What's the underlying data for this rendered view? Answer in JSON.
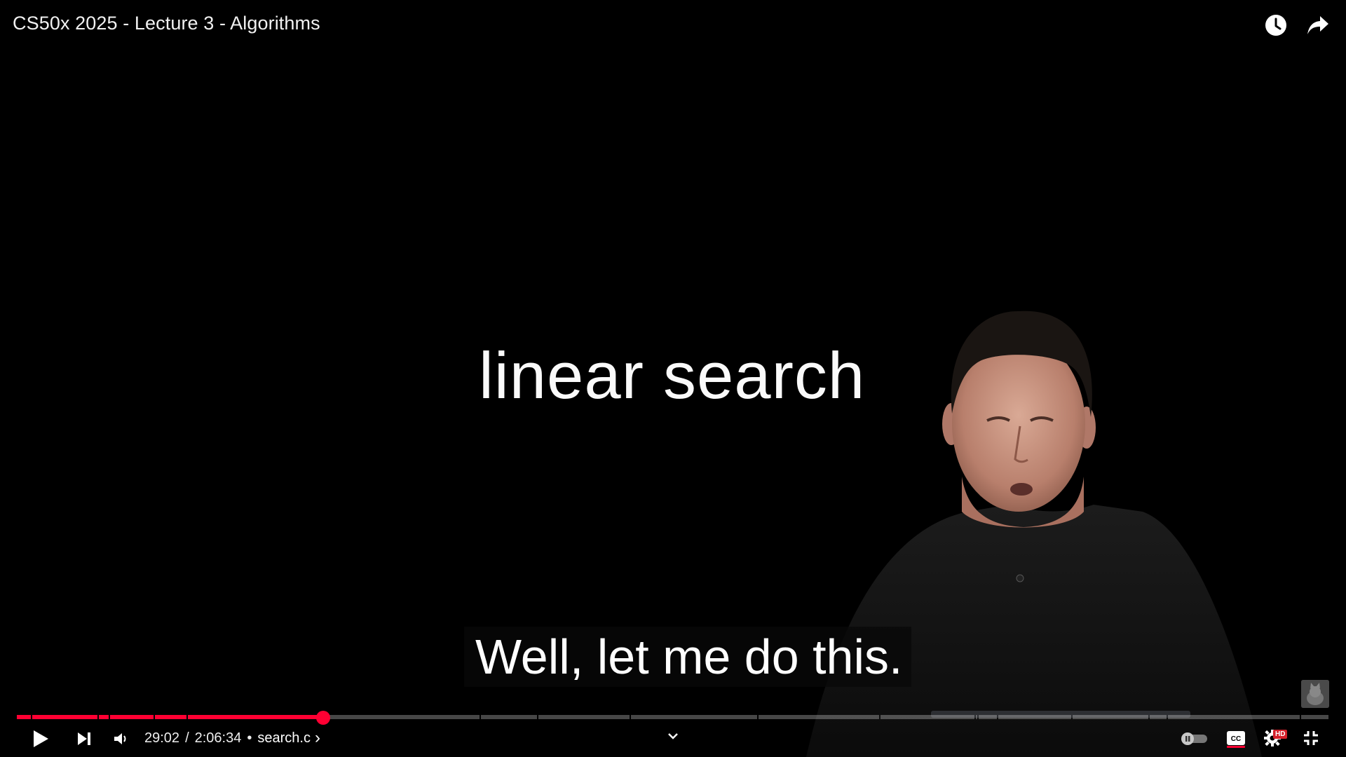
{
  "video": {
    "title": "CS50x 2025 - Lecture 3 - Algorithms",
    "slide_text": "linear search",
    "caption": "Well, let me do this."
  },
  "top_actions": {
    "watch_later_icon": "clock-icon",
    "share_icon": "share-arrow-icon"
  },
  "player": {
    "current_time": "29:02",
    "time_separator": "/",
    "duration": "2:06:34",
    "chapter_bullet": "•",
    "chapter": "search.c",
    "chapter_chevron": "›",
    "progress_fraction": 0.2295,
    "accent_color": "#ff0033",
    "hd_badge": "HD"
  },
  "controls": {
    "play_icon": "play-icon",
    "next_icon": "next-icon",
    "volume_icon": "volume-icon",
    "expand_icon": "chevron-down-icon",
    "autoplay_icon": "autoplay-toggle-icon",
    "captions_icon": "cc-icon",
    "settings_icon": "gear-icon",
    "fullscreen_icon": "exit-fullscreen-icon"
  }
}
